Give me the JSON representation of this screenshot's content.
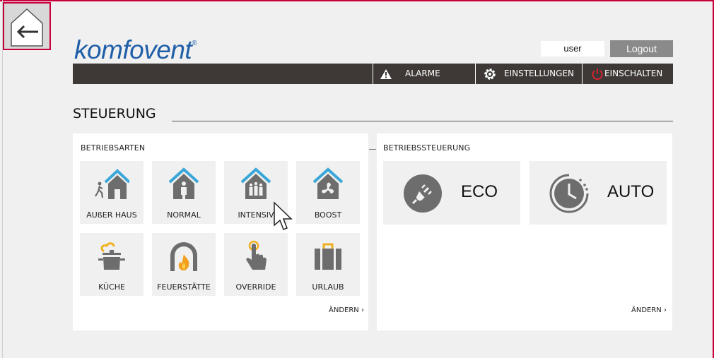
{
  "brand": {
    "logo_text": "komfovent",
    "trademark": "®",
    "color": "#1f5fa8"
  },
  "header": {
    "user_label": "user",
    "logout_label": "Logout"
  },
  "nav": {
    "alarm_label": "ALARME",
    "settings_label": "EINSTELLUNGEN",
    "power_label": "EINSCHALTEN"
  },
  "page": {
    "title": "STEUERUNG"
  },
  "modes": {
    "heading": "BETRIEBSARTEN",
    "items": [
      {
        "label": "AUßER HAUS",
        "icon": "away-house-icon"
      },
      {
        "label": "NORMAL",
        "icon": "normal-house-icon"
      },
      {
        "label": "INTENSIV",
        "icon": "intensive-house-icon"
      },
      {
        "label": "BOOST",
        "icon": "boost-house-icon"
      },
      {
        "label": "KÜCHE",
        "icon": "kitchen-pot-icon"
      },
      {
        "label": "FEUERSTÄTTE",
        "icon": "fireplace-icon"
      },
      {
        "label": "OVERRIDE",
        "icon": "override-hand-icon"
      },
      {
        "label": "URLAUB",
        "icon": "holiday-suitcase-icon"
      }
    ],
    "change_label": "ÄNDERN ›"
  },
  "control": {
    "heading": "BETRIEBSSTEUERUNG",
    "eco_label": "ECO",
    "auto_label": "AUTO",
    "change_label": "ÄNDERN ›"
  },
  "colors": {
    "accent_red": "#c8003c",
    "navbar": "#3e3937",
    "icon_gray": "#6d6d6d",
    "roof_blue": "#3aa7d8",
    "pot_yellow": "#f2b01e"
  }
}
